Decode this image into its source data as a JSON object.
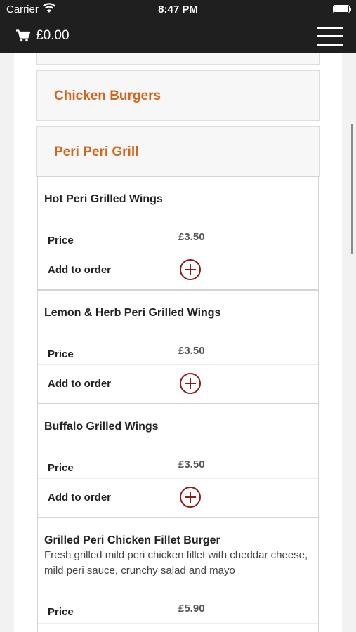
{
  "status_bar": {
    "carrier": "Carrier",
    "time": "8:47 PM"
  },
  "nav": {
    "cart_total": "£0.00"
  },
  "categories": [
    {
      "title": "Chicken Burgers"
    },
    {
      "title": "Peri Peri Grill"
    }
  ],
  "labels": {
    "price": "Price",
    "add_to_order": "Add to order"
  },
  "items": [
    {
      "name": "Hot Peri Grilled Wings",
      "price": "£3.50"
    },
    {
      "name": "Lemon & Herb Peri Grilled Wings",
      "price": "£3.50"
    },
    {
      "name": "Buffalo Grilled Wings",
      "price": "£3.50"
    },
    {
      "name": "Grilled Peri Chicken Fillet Burger",
      "description": "Fresh grilled mild peri chicken fillet with cheddar cheese, mild peri sauce, crunchy salad and mayo",
      "price": "£5.90"
    }
  ],
  "colors": {
    "category_title": "#d2661c",
    "add_icon": "#8b1a1a",
    "nav_background": "#1f1f1f"
  },
  "icons": {
    "cart": "cart-icon",
    "menu": "hamburger-menu-icon",
    "add": "plus-circle-icon",
    "wifi": "wifi-icon",
    "battery": "battery-icon"
  }
}
